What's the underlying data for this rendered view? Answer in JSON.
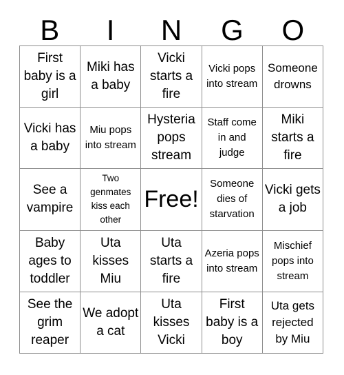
{
  "card": {
    "title": "BINGO",
    "header_letters": [
      "B",
      "I",
      "N",
      "G",
      "O"
    ],
    "free_space_label": "Free!",
    "colors": {
      "background": "#ffffff",
      "border": "#8c8c8c",
      "text": "#000000"
    },
    "grid": {
      "columns": 5,
      "rows": 5,
      "cells": [
        {
          "text": "First baby is a girl",
          "size": "lg",
          "free": false
        },
        {
          "text": "Miki has a baby",
          "size": "lg",
          "free": false
        },
        {
          "text": "Vicki starts a fire",
          "size": "lg",
          "free": false
        },
        {
          "text": "Vicki pops into stream",
          "size": "sm",
          "free": false
        },
        {
          "text": "Someone drowns",
          "size": "md",
          "free": false
        },
        {
          "text": "Vicki has a baby",
          "size": "lg",
          "free": false
        },
        {
          "text": "Miu pops into stream",
          "size": "sm",
          "free": false
        },
        {
          "text": "Hysteria pops stream",
          "size": "lg",
          "free": false
        },
        {
          "text": "Staff come in and judge",
          "size": "sm",
          "free": false
        },
        {
          "text": "Miki starts a fire",
          "size": "lg",
          "free": false
        },
        {
          "text": "See a vampire",
          "size": "lg",
          "free": false
        },
        {
          "text": "Two genmates kiss each other",
          "size": "xs",
          "free": false
        },
        {
          "text": "Free!",
          "size": "xl",
          "free": true
        },
        {
          "text": "Someone dies of starvation",
          "size": "sm",
          "free": false
        },
        {
          "text": "Vicki gets a job",
          "size": "lg",
          "free": false
        },
        {
          "text": "Baby ages to toddler",
          "size": "lg",
          "free": false
        },
        {
          "text": "Uta kisses Miu",
          "size": "lg",
          "free": false
        },
        {
          "text": "Uta starts a fire",
          "size": "lg",
          "free": false
        },
        {
          "text": "Azeria pops into stream",
          "size": "sm",
          "free": false
        },
        {
          "text": "Mischief pops into stream",
          "size": "sm",
          "free": false
        },
        {
          "text": "See the grim reaper",
          "size": "lg",
          "free": false
        },
        {
          "text": "We adopt a cat",
          "size": "lg",
          "free": false
        },
        {
          "text": "Uta kisses Vicki",
          "size": "lg",
          "free": false
        },
        {
          "text": "First baby is a boy",
          "size": "lg",
          "free": false
        },
        {
          "text": "Uta gets rejected by Miu",
          "size": "md",
          "free": false
        }
      ]
    }
  }
}
